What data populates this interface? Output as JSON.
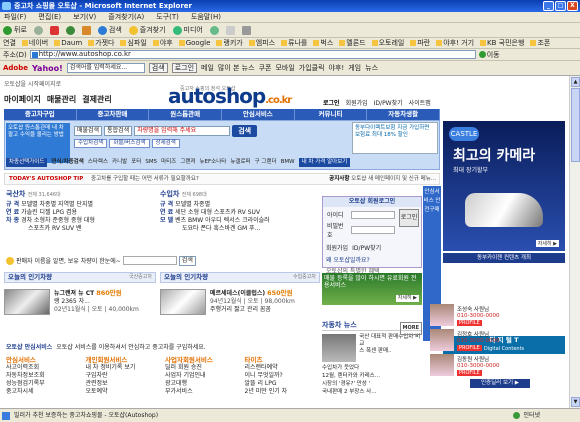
{
  "window": {
    "title": "중고차 쇼핑몰 오토샵 - Microsoft Internet Explorer",
    "min": "_",
    "max": "□",
    "close": "X"
  },
  "menu": [
    "파일(F)",
    "편집(E)",
    "보기(V)",
    "즐겨찾기(A)",
    "도구(T)",
    "도움말(H)"
  ],
  "toolbar": {
    "back": "뒤로",
    "search": "검색",
    "favorites": "즐겨찾기",
    "media": "미디어"
  },
  "links_label": "연결",
  "links": [
    "네이버",
    "Daum",
    "가젯다",
    "심파일",
    "야후",
    "Google",
    "랭키가",
    "엠피스",
    "류나를",
    "벅스",
    "멜론드",
    "오토레일",
    "파란",
    "야후! 거기",
    "KB 국민은행",
    "조폰"
  ],
  "address": {
    "label": "주소(D)",
    "url": "http://www.autoshop.co.kr",
    "go": "이동"
  },
  "yahoo_bar": {
    "brand": "Yahoo!",
    "adobe": "Adobe",
    "search_placeholder": "검색어를 입력하세요...",
    "search": "검색",
    "login": "로그인",
    "mail": "메일",
    "news": "많이 본 뉴스",
    "coupon": "쿠폰",
    "mobile": "모바일",
    "price": "가입클릭",
    "yahoo": "야후!",
    "game": "게임",
    "news2": "뉴스"
  },
  "site": {
    "breadcrumb": "오토샵을 시작페이지로",
    "logo": "autoshop",
    "logo_kr": ".co.kr",
    "logo_tag": "중고자 쇼핑의 정석 오토샵",
    "nav": [
      "마이페이지",
      "매물관리",
      "결제관리"
    ],
    "toplinks": [
      "로그인",
      "회원가입",
      "ID/PW찾기",
      "사이트맵"
    ],
    "mainnav": [
      "중고차구입",
      "중고차판매",
      "원스톱관매",
      "안심서비스",
      "커뮤니티",
      "자동차생활"
    ],
    "promo": "오토샵 원스톱관매 내 차 팔고 수익을 올리는 방법",
    "search": {
      "select": "매물검색",
      "select2": "통합검색",
      "placeholder": "차량명을 입력해 주세요",
      "button": "검색"
    },
    "chips": [
      "수입차검색",
      "화물/버스검색",
      "상세검색"
    ],
    "right_promo": "동부다이렉트보험 지금 가입하면 보험료 최대 18% 할인",
    "navrow_label": "차종선택가이드",
    "navrow_label2": "연식/차종검색",
    "navrow": [
      "스타렉스",
      "카니발",
      "포터",
      "SM5",
      "마티즈",
      "그랜져",
      "뉴EF소나타",
      "뉴갤로퍼",
      "구 그랜더",
      "BMW"
    ],
    "navrow_right": "내 차 가격 알아보기",
    "ad": {
      "brand": "TODAY'S AUTOSHOP TIP",
      "text": "중고차를 구입할 때는 어떤 서류가 필요할까요?",
      "right_title": "공지사항",
      "right": "오토샵 새 메인페이지 및 신규 메뉴..."
    },
    "domestic": {
      "title": "국산차",
      "count": "전체 31,646대",
      "rows": [
        {
          "k": "규 격",
          "v": "모델별 차종별 지역별 단지별"
        },
        {
          "k": "연 료",
          "v": "가솔린 디젤 LPG 겸용"
        },
        {
          "k": "차 종",
          "v": "경차 소형차 준중형 중형 대형"
        },
        {
          "k": "",
          "v": "스포츠카 RV SUV 밴"
        }
      ]
    },
    "imported": {
      "title": "수입차",
      "count": "전체 698대",
      "rows": [
        {
          "k": "규 격",
          "v": "모델별 차종별"
        },
        {
          "k": "연 료",
          "v": "세단 소형 대형 스포츠카 RV SUV"
        },
        {
          "k": "모 델",
          "v": "벤츠 BMW 아우디 렉서스 크라이슬러"
        },
        {
          "k": "",
          "v": "도요타 폰다 혹스바겐 GM 푸..."
        }
      ]
    },
    "name_prompt": "판매자 이름을 알면, 보유 차량이 한눈에~",
    "name_btn": "검색",
    "hot_domestic": {
      "title": "오늘의 인기차량",
      "sub": "국산중고차",
      "car": "뉴그랜져 뉴 CT",
      "price": "860만원",
      "detail": "02년11월식 | 오토 | 40,000km",
      "extra": "랭 2365 자..."
    },
    "hot_imported": {
      "title": "오늘의 인기차량",
      "sub": "수입중고차",
      "car": "메르세데스(이클럽스)",
      "price": "650만원",
      "detail": "94년12월식 | 오토 | 98,000km",
      "extra": "주행거리 짧고 관리 꼼꼼"
    },
    "safe": {
      "label": "오토샵 안심서비스",
      "text": "오토샵 서비스를 이용하셔서 안심하고 중고차를 구입하세요."
    },
    "services": [
      {
        "h": "안심서비스",
        "items": [
          "사고이력조회",
          "자동차정보조회",
          "성능점검기록부",
          "중고차시세"
        ]
      },
      {
        "h": "개인회원서비스",
        "items": [
          "내 차 정비기록 보기",
          "구입자란",
          "관련정보",
          "오토예약"
        ]
      },
      {
        "h": "사업자회원서비스",
        "items": [
          "딜러 회원 승진",
          "사업자 기업인내",
          "광고대행",
          "부가서비스"
        ]
      },
      {
        "h": "타이츠",
        "items": [
          "리스랜타예약",
          "이니 무엇일까?",
          "알뜰 리 LPG",
          "2년 미만 인기 차"
        ]
      }
    ],
    "login": {
      "title": "오토샵 회원로그인",
      "id": "아이디",
      "pw": "비밀번호",
      "btn": "로그인",
      "join": "회원가입",
      "find": "ID/PW찾기",
      "q": "왜 오토샵일까요?",
      "q2": "오토샵의 특별한 혜택"
    },
    "green": {
      "text": "매물 등록을 많이 하시면 유료회원 전용서비스",
      "go": "자세히 ▶"
    },
    "news": {
      "title": "자동차 뉴스",
      "more": "MORE",
      "items": [
        "국산 대표적 판매수입차 비교",
        "스 폭센 판매..",
        "수입차가 웃었다",
        "12월, 렌터카와 카레스...",
        "시장의 '경유?' 만성 '",
        "국내판매 2 부장스 사..."
      ]
    },
    "vertical": "안심서비스 안전구매",
    "bigad": {
      "logo": "CASTLE",
      "title": "최고의 카메라",
      "sub": "최대 장기할부",
      "btn": "자세히 ▶",
      "link": "동부카이젠 컨텐츠 개최"
    },
    "lightbox": {
      "a": "디 지 털 T",
      "b": "Digital Contents"
    },
    "agents": [
      {
        "name": "조성숙 사원님",
        "phone": "010-3000-0000",
        "pf": "PROFILE"
      },
      {
        "name": "김정호 사원님",
        "phone": "010-3000-0000",
        "pf": "PROFILE"
      },
      {
        "name": "김동원 사원님",
        "phone": "010-3000-0000",
        "pf": "PROFILE"
      }
    ],
    "more_agents": "인증딜러 보기 ▶"
  },
  "status": {
    "text": "빌러가 추천 보증하는 중고차쇼핑몰 - 오토샵(Autoshop)",
    "zone": "인터넷"
  }
}
